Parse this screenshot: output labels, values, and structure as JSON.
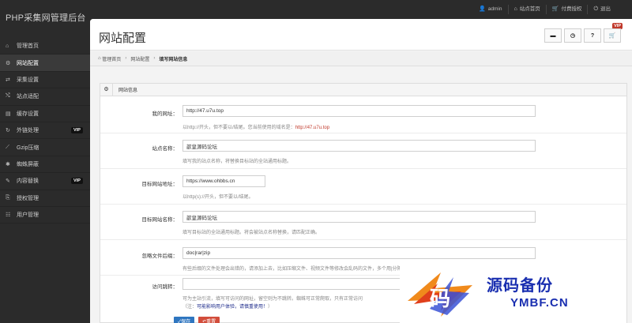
{
  "brand": "PHP采集网管理后台",
  "topnav": [
    {
      "icon": "user-icon",
      "glyph": "👤",
      "label": "admin"
    },
    {
      "icon": "home-icon",
      "glyph": "⌂",
      "label": "站点首页"
    },
    {
      "icon": "cart-icon",
      "glyph": "🛒",
      "label": "付费授权"
    },
    {
      "icon": "logout-icon",
      "glyph": "⏻",
      "label": "退出"
    }
  ],
  "sidebar": {
    "items": [
      {
        "label": "管理首页",
        "glyph": "⌂"
      },
      {
        "label": "网站配置",
        "glyph": "⚙",
        "active": true
      },
      {
        "label": "采集设置",
        "glyph": "⇄"
      },
      {
        "label": "站点适配",
        "glyph": "⤭"
      },
      {
        "label": "缓存设置",
        "glyph": "▤"
      },
      {
        "label": "外链处理",
        "glyph": "↻",
        "vip": "VIP"
      },
      {
        "label": "Gzip压缩",
        "glyph": "⟋"
      },
      {
        "label": "蜘蛛屏蔽",
        "glyph": "✱"
      },
      {
        "label": "内容替换",
        "glyph": "✎",
        "vip": "VIP"
      },
      {
        "label": "授权管理",
        "glyph": "⎘"
      },
      {
        "label": "用户管理",
        "glyph": "☷"
      }
    ]
  },
  "page": {
    "title": "网站配置",
    "vip_badge": "VIP",
    "header_buttons": [
      {
        "icon": "comment-icon",
        "glyph": "▬"
      },
      {
        "icon": "clock-icon",
        "glyph": "◷"
      },
      {
        "icon": "help-icon",
        "glyph": "?"
      },
      {
        "icon": "cart-icon",
        "glyph": "🛒"
      }
    ]
  },
  "breadcrumb": [
    "管理首页",
    "网站配置",
    "填写网站信息"
  ],
  "form": {
    "box_title": "网站信息",
    "fields": [
      {
        "label": "我的网址：",
        "value": "http://47.u7u.top",
        "help": "以http://开头，但不要以/结尾。您当前使用的域名是：",
        "help_red": "http://47.u7u.top"
      },
      {
        "label": "站点名称：",
        "value": "歆皇源码论坛",
        "help": "填写我的站点名称，将替换目标站的全站通用标题。"
      },
      {
        "label": "目标网站地址：",
        "value": "https://www.ohbbs.cn",
        "help": "以http(s)://开头，但不要以/结尾。"
      },
      {
        "label": "目标网站名称：",
        "value": "歆皇源码论坛",
        "help": "填写目标站的全站通用标题。将会被站点名称替换，请匹配正确。"
      },
      {
        "label": "忽略文件后缀：",
        "value": "doc|rar|zip",
        "help": "有些后缀的文件处理会出错的，请添加上去，比如压缩文件、视频文件等修改会乱码的文件，多个用|分隔"
      },
      {
        "label": "访问跳转：",
        "value": "",
        "help": "可为主站引流，填写可访问的网址，留空则为不跳转。蜘蛛可正常爬取，只有正常访问",
        "help2_prefix": "（注：",
        "help2_warn": "可能影响用户体验，请慎重使用！",
        "help2_suffix": "）"
      }
    ],
    "save_label": "✓保存",
    "reset_label": "↶重置"
  },
  "watermark": {
    "cn": "源码备份",
    "en": "YMBF.CN",
    "logo_char": "码"
  }
}
